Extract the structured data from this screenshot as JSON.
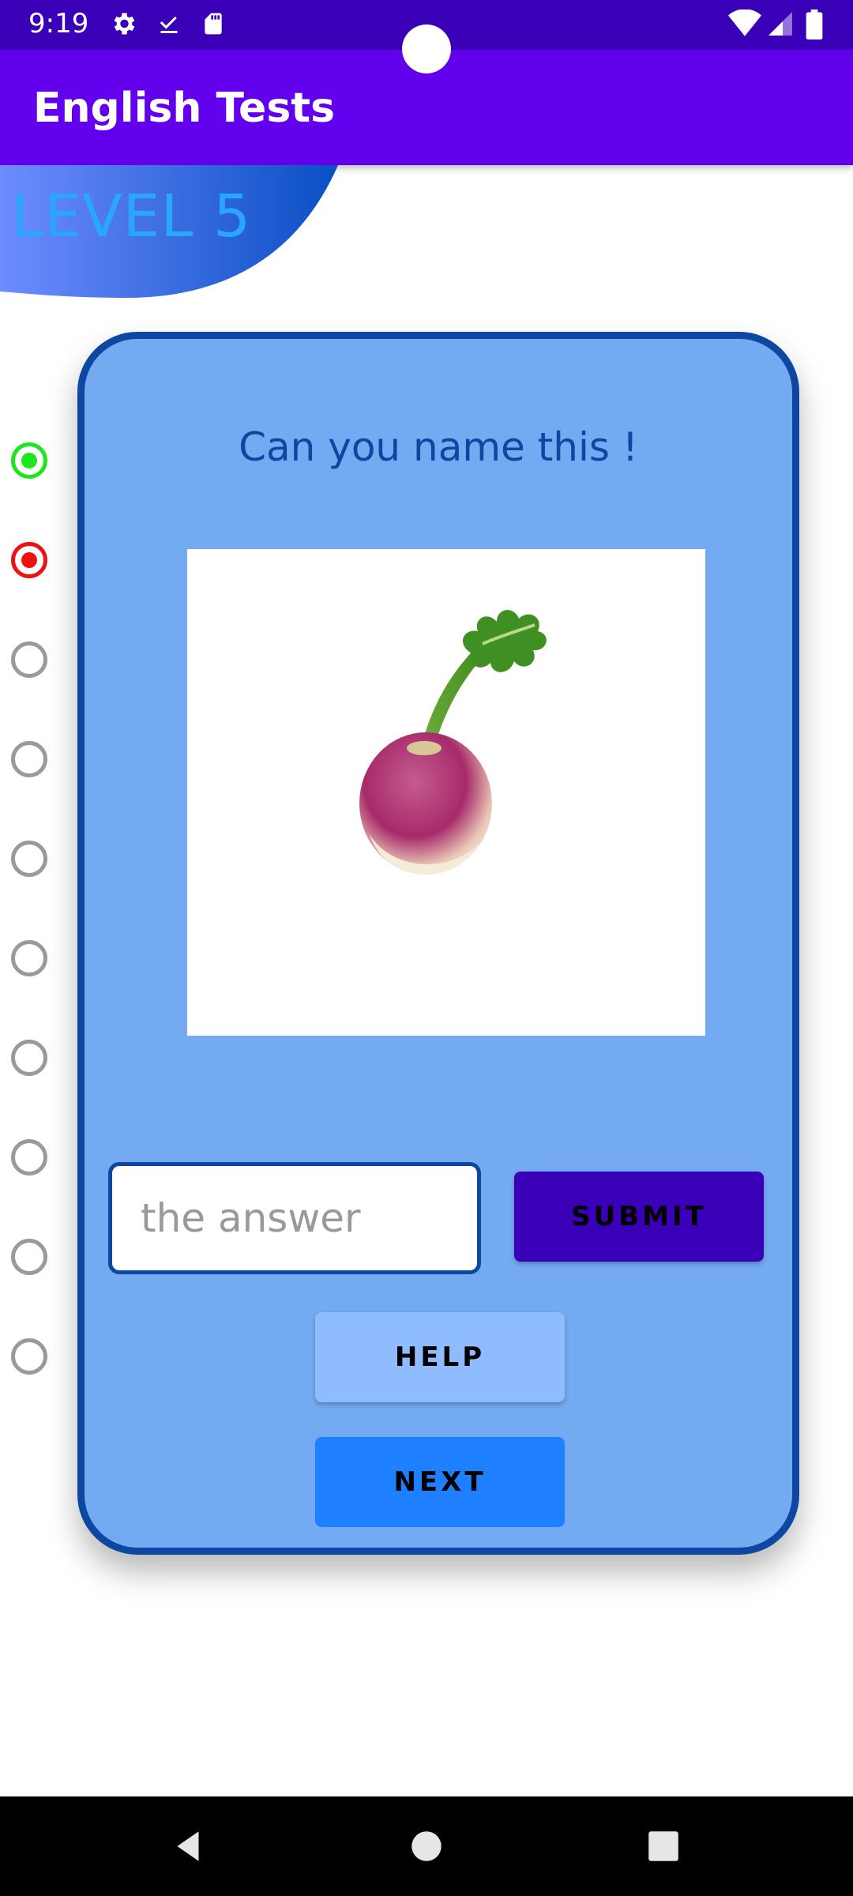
{
  "status_bar": {
    "time": "9:19",
    "left_icons": [
      "settings-icon",
      "download-done-icon",
      "sd-card-icon"
    ],
    "right_icons": [
      "wifi-icon",
      "signal-icon",
      "battery-icon"
    ]
  },
  "app_bar": {
    "title": "English Tests"
  },
  "level": {
    "label": "LEVEL 5"
  },
  "progress": {
    "items": [
      {
        "state": "correct"
      },
      {
        "state": "wrong"
      },
      {
        "state": "pending"
      },
      {
        "state": "pending"
      },
      {
        "state": "pending"
      },
      {
        "state": "pending"
      },
      {
        "state": "pending"
      },
      {
        "state": "pending"
      },
      {
        "state": "pending"
      },
      {
        "state": "pending"
      }
    ]
  },
  "card": {
    "question": "Can you name this !",
    "image_subject": "turnip-image",
    "answer_placeholder": "the answer",
    "answer_value": "",
    "submit_label": "SUBMIT",
    "help_label": "HELP",
    "next_label": "NEXT"
  },
  "colors": {
    "status_bar": "#3a00b8",
    "app_bar": "#6200ee",
    "card_bg": "#74aaf2",
    "card_border": "#0d47a1",
    "correct": "#1ee61e",
    "wrong": "#ee1111",
    "submit": "#3a00b8",
    "help": "#8ebcff",
    "next": "#1e80ff"
  },
  "nav_bar": {
    "icons": [
      "back-icon",
      "home-icon",
      "recents-icon"
    ]
  }
}
